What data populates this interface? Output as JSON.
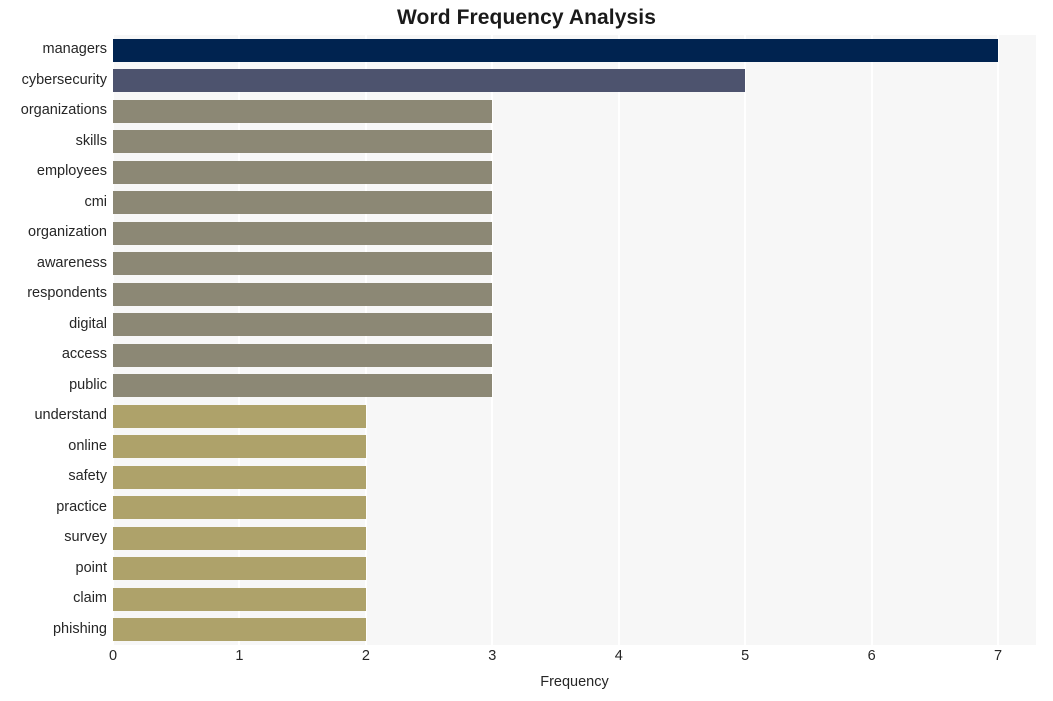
{
  "chart_data": {
    "type": "bar",
    "orientation": "horizontal",
    "title": "Word Frequency Analysis",
    "xlabel": "Frequency",
    "ylabel": "",
    "xlim": [
      0,
      7.3
    ],
    "xticks": [
      "0",
      "1",
      "2",
      "3",
      "4",
      "5",
      "6",
      "7"
    ],
    "xtick_values": [
      0,
      1,
      2,
      3,
      4,
      5,
      6,
      7
    ],
    "grid": "vertical-white-gridlines",
    "legend": "none",
    "categories": [
      "managers",
      "cybersecurity",
      "organizations",
      "skills",
      "employees",
      "cmi",
      "organization",
      "awareness",
      "respondents",
      "digital",
      "access",
      "public",
      "understand",
      "online",
      "safety",
      "practice",
      "survey",
      "point",
      "claim",
      "phishing"
    ],
    "values": [
      7,
      5,
      3,
      3,
      3,
      3,
      3,
      3,
      3,
      3,
      3,
      3,
      2,
      2,
      2,
      2,
      2,
      2,
      2,
      2
    ],
    "bar_colors": [
      "#002350",
      "#4d536e",
      "#8c8875",
      "#8c8875",
      "#8c8875",
      "#8c8875",
      "#8c8875",
      "#8c8875",
      "#8c8875",
      "#8c8875",
      "#8c8875",
      "#8c8875",
      "#aea26a",
      "#aea26a",
      "#aea26a",
      "#aea26a",
      "#aea26a",
      "#aea26a",
      "#aea26a",
      "#aea26a"
    ],
    "plot_background": "#f7f7f7",
    "figure_background": "#ffffff",
    "gridline_color": "#ffffff"
  }
}
